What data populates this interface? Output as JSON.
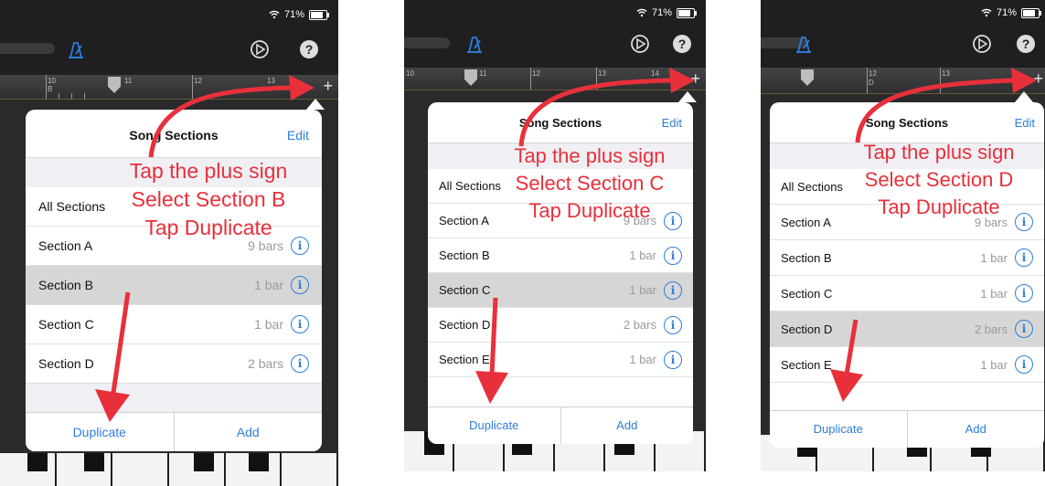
{
  "status": {
    "battery": "71%"
  },
  "popover": {
    "title": "Song Sections",
    "edit": "Edit",
    "all_sections": "All Sections",
    "duplicate": "Duplicate",
    "add": "Add"
  },
  "colors": {
    "accent": "#2f7ddb",
    "annotation": "#e8303a",
    "selected_row": "#d6d6d6"
  },
  "icons": [
    "wifi-icon",
    "battery-icon",
    "metronome-icon",
    "settings-icon",
    "help-icon",
    "plus-icon",
    "info-icon"
  ],
  "panels": [
    {
      "ruler": [
        "10",
        "B",
        "11",
        "12",
        "13"
      ],
      "instructions": [
        "Tap the plus sign",
        "Select Section B",
        "Tap Duplicate"
      ],
      "rows": [
        {
          "name": "Section A",
          "bars": "9 bars"
        },
        {
          "name": "Section B",
          "bars": "1 bar"
        },
        {
          "name": "Section C",
          "bars": "1 bar"
        },
        {
          "name": "Section D",
          "bars": "2 bars"
        }
      ]
    },
    {
      "ruler": [
        "10",
        "11",
        "12",
        "13",
        "14"
      ],
      "instructions": [
        "Tap the plus sign",
        "Select Section C",
        "Tap Duplicate"
      ],
      "rows": [
        {
          "name": "Section A",
          "bars": "9 bars"
        },
        {
          "name": "Section B",
          "bars": "1 bar"
        },
        {
          "name": "Section C",
          "bars": "1 bar"
        },
        {
          "name": "Section D",
          "bars": "2 bars"
        },
        {
          "name": "Section E",
          "bars": "1 bar"
        }
      ]
    },
    {
      "ruler": [
        "12",
        "D",
        "13"
      ],
      "instructions": [
        "Tap the plus sign",
        "Select Section D",
        "Tap Duplicate"
      ],
      "rows": [
        {
          "name": "Section A",
          "bars": "9 bars"
        },
        {
          "name": "Section B",
          "bars": "1 bar"
        },
        {
          "name": "Section C",
          "bars": "1 bar"
        },
        {
          "name": "Section D",
          "bars": "2 bars"
        },
        {
          "name": "Section E",
          "bars": "1 bar"
        }
      ]
    }
  ]
}
